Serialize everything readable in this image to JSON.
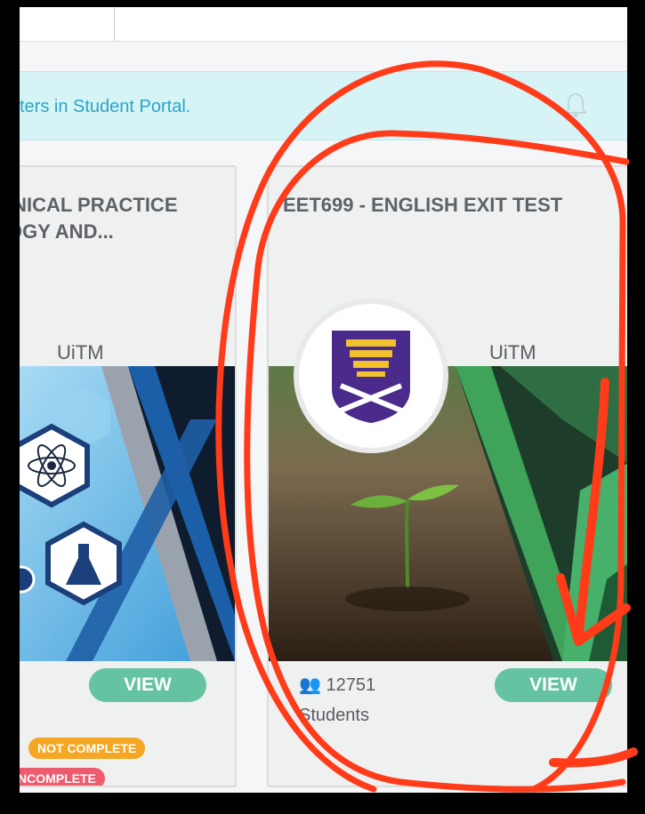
{
  "banner": {
    "text": "ters in Student Portal."
  },
  "cards": [
    {
      "title_line1": "INICAL PRACTICE",
      "title_line2": "OGY AND...",
      "provider": "UiTM",
      "view_label": "VIEW",
      "badges": [
        "NOT COMPLETE",
        "NCOMPLETE"
      ]
    },
    {
      "title_line1": "EET699 - ENGLISH EXIT TEST",
      "provider": "UiTM",
      "view_label": "VIEW",
      "students_count": "12751",
      "students_label": "Students"
    }
  ],
  "colors": {
    "accent_teal": "#64c3a0",
    "banner_text": "#2aa6c6",
    "badge_orange": "#f5a623",
    "badge_red": "#ef5b6e",
    "annotation_red": "#ff3b1a"
  }
}
